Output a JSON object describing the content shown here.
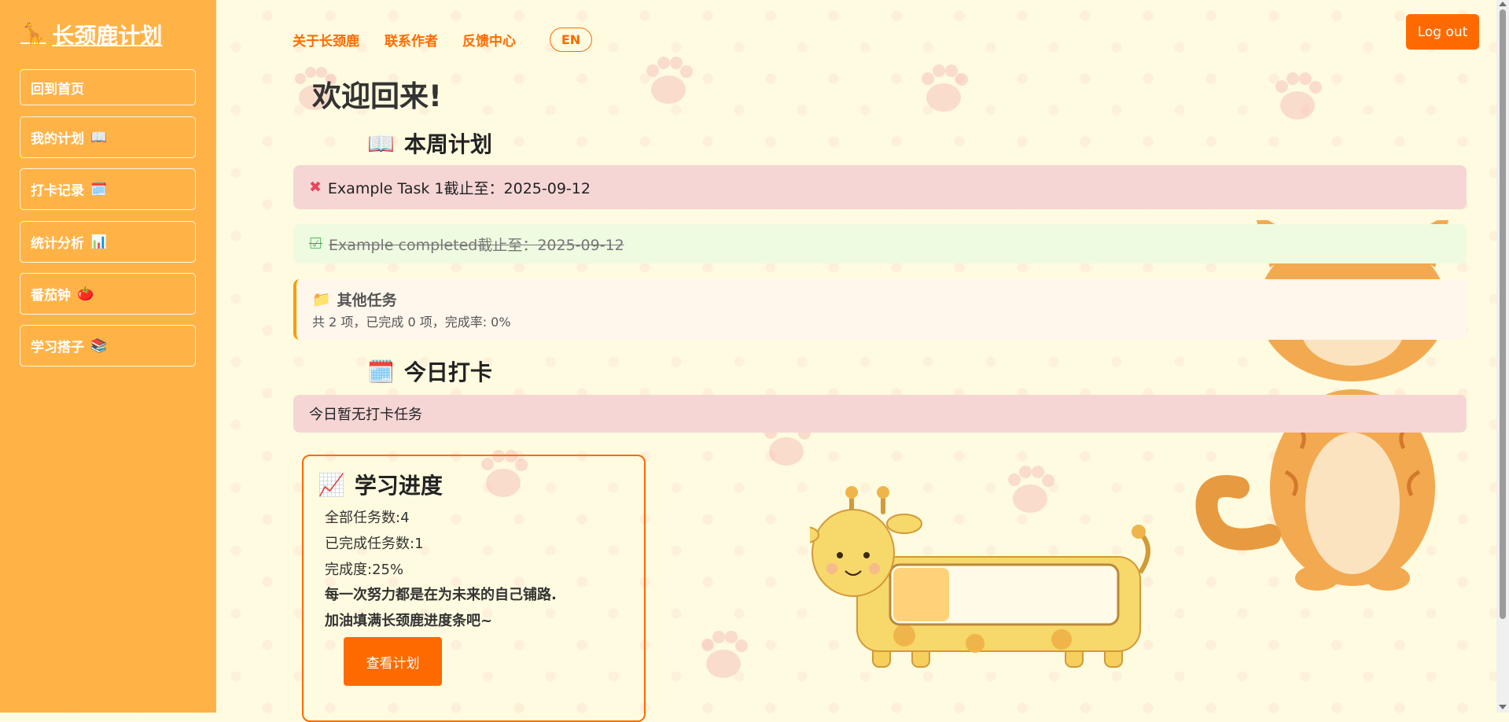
{
  "sidebar": {
    "brand": "长颈鹿计划",
    "brand_icon": "giraffe-icon",
    "items": [
      {
        "label": "回到首页",
        "icon": ""
      },
      {
        "label": "我的计划",
        "icon": "book-icon"
      },
      {
        "label": "打卡记录",
        "icon": "calendar-icon"
      },
      {
        "label": "统计分析",
        "icon": "bar-chart-icon"
      },
      {
        "label": "番茄钟",
        "icon": "tomato-icon"
      },
      {
        "label": "学习搭子",
        "icon": "books-icon"
      }
    ]
  },
  "topnav": {
    "about": "关于长颈鹿",
    "contact": "联系作者",
    "feedback": "反馈中心",
    "lang": "EN",
    "logout": "Log out"
  },
  "welcome": "欢迎回来!",
  "weekly": {
    "title": "本周计划",
    "tasks": [
      {
        "status": "pending",
        "text": "Example Task 1截止至：2025-09-12"
      },
      {
        "status": "done",
        "text": "Example completed截止至：2025-09-12"
      }
    ],
    "other": {
      "title": "其他任务",
      "summary": "共 2 项，已完成 0 项，完成率: 0%"
    }
  },
  "checkin": {
    "title": "今日打卡",
    "empty": "今日暂无打卡任务"
  },
  "progress": {
    "title": "学习进度",
    "total": "全部任务数:4",
    "completed": "已完成任务数:1",
    "rate": "完成度:25%",
    "motto1": "每一次努力都是在为未来的自己铺路.",
    "motto2": "加油填满长颈鹿进度条吧~",
    "button": "查看计划",
    "fill_fraction": 0.25
  },
  "colors": {
    "accent": "#ff6a00",
    "sidebar": "#ffb347",
    "pending": "#f6d5d5",
    "done": "#eefbe0"
  }
}
